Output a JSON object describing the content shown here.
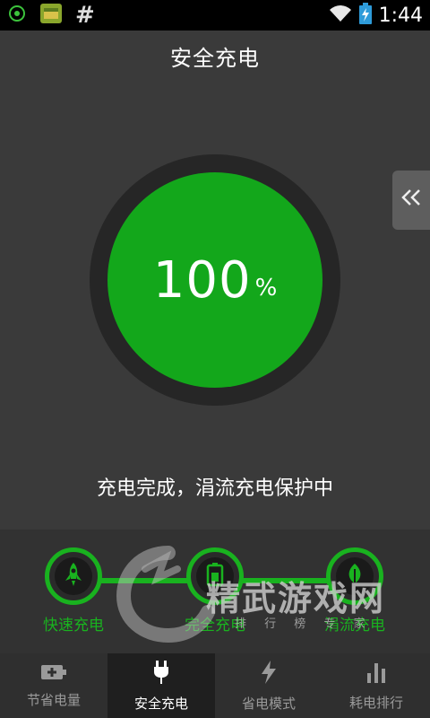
{
  "status_bar": {
    "time": "1:44",
    "hash": "#"
  },
  "header": {
    "title": "安全充电"
  },
  "meter": {
    "value": "100",
    "unit": "%",
    "level": 100
  },
  "status_text": "充电完成，涓流充电保护中",
  "steps": [
    {
      "label": "快速充电",
      "icon": "rocket-icon"
    },
    {
      "label": "完全充电",
      "icon": "battery-icon"
    },
    {
      "label": "涓流充电",
      "icon": "leaf-icon"
    }
  ],
  "watermark": {
    "text": "精武游戏网",
    "sub": "排 行 榜 专 家"
  },
  "nav": {
    "items": [
      {
        "label": "节省电量",
        "icon": "battery-plus-icon",
        "active": false
      },
      {
        "label": "安全充电",
        "icon": "plug-icon",
        "active": true
      },
      {
        "label": "省电模式",
        "icon": "lightning-icon",
        "active": false
      },
      {
        "label": "耗电排行",
        "icon": "bar-chart-icon",
        "active": false
      }
    ]
  },
  "colors": {
    "accent": "#19b21f",
    "meter_fill": "#13a71b",
    "background": "#3a3a3a"
  }
}
